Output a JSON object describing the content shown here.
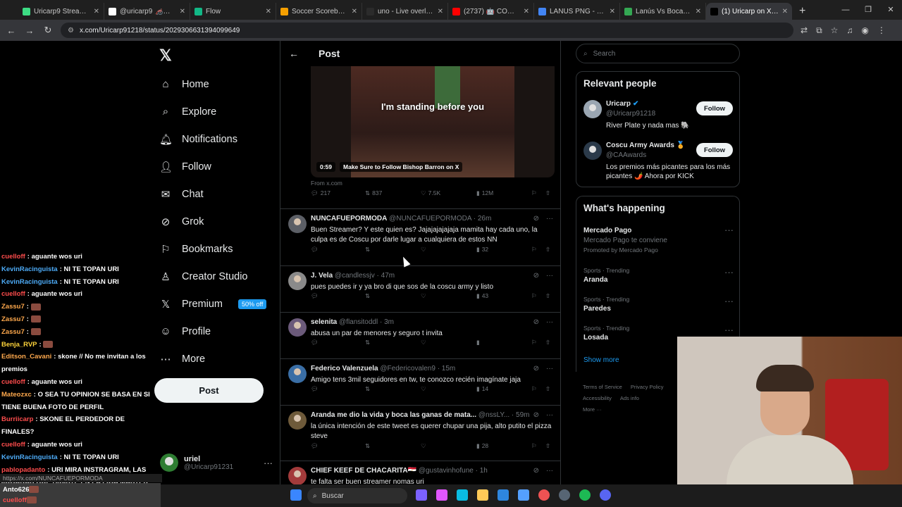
{
  "browser": {
    "tabs": [
      {
        "title": "Uricarp9 Stream - Wa",
        "color": "#3ddc84"
      },
      {
        "title": "@uricarp9 🦽🦽 #fu",
        "color": "#ffffff"
      },
      {
        "title": "Flow",
        "color": "#12b886"
      },
      {
        "title": "Soccer Scorebug - Sl",
        "color": "#f59f00"
      },
      {
        "title": "uno - Live overlays fo",
        "color": "#2b2b2b"
      },
      {
        "title": "(2737) 🤖 COMO PO",
        "color": "#ff0000"
      },
      {
        "title": "LANUS PNG - Buscar",
        "color": "#4285f4"
      },
      {
        "title": "Lanús Vs Boca Junior",
        "color": "#34a853"
      },
      {
        "title": "(1) Uricarp on X: \"A q",
        "color": "#000000"
      }
    ],
    "url": "x.com/Uricarp91218/status/2029306631394099649"
  },
  "nav": {
    "logo": "𝕏",
    "items": [
      {
        "label": "Home",
        "icon": "⌂",
        "icon_name": "home-icon"
      },
      {
        "label": "Explore",
        "icon": "⌕",
        "icon_name": "search-icon"
      },
      {
        "label": "Notifications",
        "icon": "🔔︎",
        "icon_name": "bell-icon"
      },
      {
        "label": "Follow",
        "icon": "👤︎",
        "icon_name": "follow-icon"
      },
      {
        "label": "Chat",
        "icon": "✉",
        "icon_name": "mail-icon"
      },
      {
        "label": "Grok",
        "icon": "⊘",
        "icon_name": "grok-icon"
      },
      {
        "label": "Bookmarks",
        "icon": "⚐",
        "icon_name": "bookmark-icon"
      },
      {
        "label": "Creator Studio",
        "icon": "♙",
        "icon_name": "creator-icon"
      },
      {
        "label": "Premium",
        "icon": "𝕏",
        "icon_name": "premium-icon",
        "badge": "50% off"
      },
      {
        "label": "Profile",
        "icon": "☺",
        "icon_name": "profile-icon"
      },
      {
        "label": "More",
        "icon": "⋯",
        "icon_name": "more-icon"
      }
    ],
    "post_label": "Post",
    "account": {
      "name": "uriel",
      "handle": "@Uricarp91231"
    }
  },
  "chat": {
    "messages": [
      {
        "user": "cuelloff",
        "text": "aguante wos uri",
        "color": "#ff4d4d"
      },
      {
        "user": "KevinRacinguista",
        "text": "NI TE TOPAN URI",
        "color": "#4dabf7"
      },
      {
        "user": "KevinRacinguista",
        "text": "NI TE TOPAN URI",
        "color": "#4dabf7"
      },
      {
        "user": "cuelloff",
        "text": "aguante wos uri",
        "color": "#ff4d4d"
      },
      {
        "user": "Zassu7",
        "text": "",
        "color": "#ffa94d",
        "emote": true
      },
      {
        "user": "Zassu7",
        "text": "",
        "color": "#ffa94d",
        "emote": true
      },
      {
        "user": "Zassu7",
        "text": "",
        "color": "#ffa94d",
        "emote": true
      },
      {
        "user": "Benja_RVP",
        "text": "",
        "color": "#ffd43b",
        "emote": true
      },
      {
        "user": "Editson_Cavani",
        "text": "skone // No me invitan a los premios",
        "color": "#ffa94d"
      },
      {
        "user": "cuelloff",
        "text": "aguante wos uri",
        "color": "#ff4d4d"
      },
      {
        "user": "Mateozxc",
        "text": "O SEA TU OPINION SE BASA EN SI TIENE BUENA FOTO DE PERFIL",
        "color": "#ffa94d"
      },
      {
        "user": "Burriicarp",
        "text": "SKONE EL PERDEDOR DE FINALES?",
        "color": "#ff4d4d"
      },
      {
        "user": "cuelloff",
        "text": "aguante wos uri",
        "color": "#ff4d4d"
      },
      {
        "user": "KevinRacinguista",
        "text": "NI TE TOPAN URI",
        "color": "#4dabf7"
      },
      {
        "user": "pablopadanto",
        "text": "URI MIRA INSTRAGRAM, LAS JUGADAS QUE HICISTE EN LA LIGA MASTER",
        "color": "#ff4d4d"
      }
    ],
    "link_hint": "https://x.com/NUNCAFUEPORMODA",
    "bottom": [
      {
        "user": "Anto626",
        "color": "#ffffff"
      },
      {
        "user": "cuelloff",
        "color": "#ff4d4d"
      }
    ]
  },
  "post": {
    "header_title": "Post",
    "video_caption": "I'm standing before you",
    "video_time": "0:59",
    "video_title": "Make Sure to Follow Bishop Barron on X",
    "from": "From x.com",
    "stats": {
      "replies": "217",
      "reposts": "837",
      "likes": "7.5K",
      "views": "12M"
    }
  },
  "replies": [
    {
      "name": "NUNCAFUEPORMODA",
      "handle": "@NUNCAFUEPORMODA",
      "time": "· 26m",
      "text": "Buen Streamer? Y este quien es? Jajajajajajaja mamita hay cada uno, la culpa es de Coscu por darle lugar a cualquiera de estos NN",
      "views": "32",
      "avcolor": "#5c5f66"
    },
    {
      "name": "J. Vela",
      "handle": "@candlessjv",
      "time": "· 47m",
      "text": "pues puedes ir y ya bro di que sos de la coscu army y listo",
      "views": "43",
      "avcolor": "#8a8a8a"
    },
    {
      "name": "selenita",
      "handle": "@flansitoddl",
      "time": "· 3m",
      "text": "abusa un par de menores y seguro t invita",
      "views": "",
      "avcolor": "#6b5a7a"
    },
    {
      "name": "Federico Valenzuela",
      "handle": "@Federicovalen9",
      "time": "· 15m",
      "text": "Amigo tens 3mil seguidores en tw, te conozco recién imagínate jaja",
      "views": "14",
      "avcolor": "#3a6ea5"
    },
    {
      "name": "Aranda me dio la vida y boca las ganas de mata...",
      "handle": "@nssLY...",
      "time": "· 59m",
      "text": "la única intención de este tweet es querer chupar una pija, alto putito el pizza steve",
      "views": "28",
      "avcolor": "#6e5a3a"
    },
    {
      "name": "CHIEF KEEF DE CHACARITA🇪🇬",
      "handle": "@gustavinhofune",
      "time": "· 1h",
      "text": "te falta ser buen streamer nomas uri",
      "views": "",
      "avcolor": "#a33b3b"
    }
  ],
  "right": {
    "search_placeholder": "Search",
    "relevant_title": "Relevant people",
    "people": [
      {
        "name": "Uricarp",
        "handle": "@Uricarp91218",
        "bio": "River Plate y nada mas 🐘",
        "follow": "Follow",
        "verified": "✔"
      },
      {
        "name": "Coscu Army Awards 🏅",
        "handle": "@CAAwards",
        "bio": "Los premios más picantes para los más picantes 🌶️ Ahora por KICK",
        "follow": "Follow",
        "verified": ""
      }
    ],
    "happening_title": "What's happening",
    "trends": [
      {
        "category": "",
        "name": "Mercado Pago",
        "sub": "Mercado Pago te conviene",
        "promo": "Promoted by Mercado Pago"
      },
      {
        "category": "Sports · Trending",
        "name": "Aranda",
        "sub": "",
        "promo": ""
      },
      {
        "category": "Sports · Trending",
        "name": "Paredes",
        "sub": "",
        "promo": ""
      },
      {
        "category": "Sports · Trending",
        "name": "Losada",
        "sub": "",
        "promo": ""
      }
    ],
    "show_more": "Show more",
    "footer": [
      "Terms of Service",
      "Privacy Policy",
      "Accessibility",
      "Ads info",
      "More ···"
    ]
  },
  "taskbar": {
    "search": "Buscar"
  }
}
